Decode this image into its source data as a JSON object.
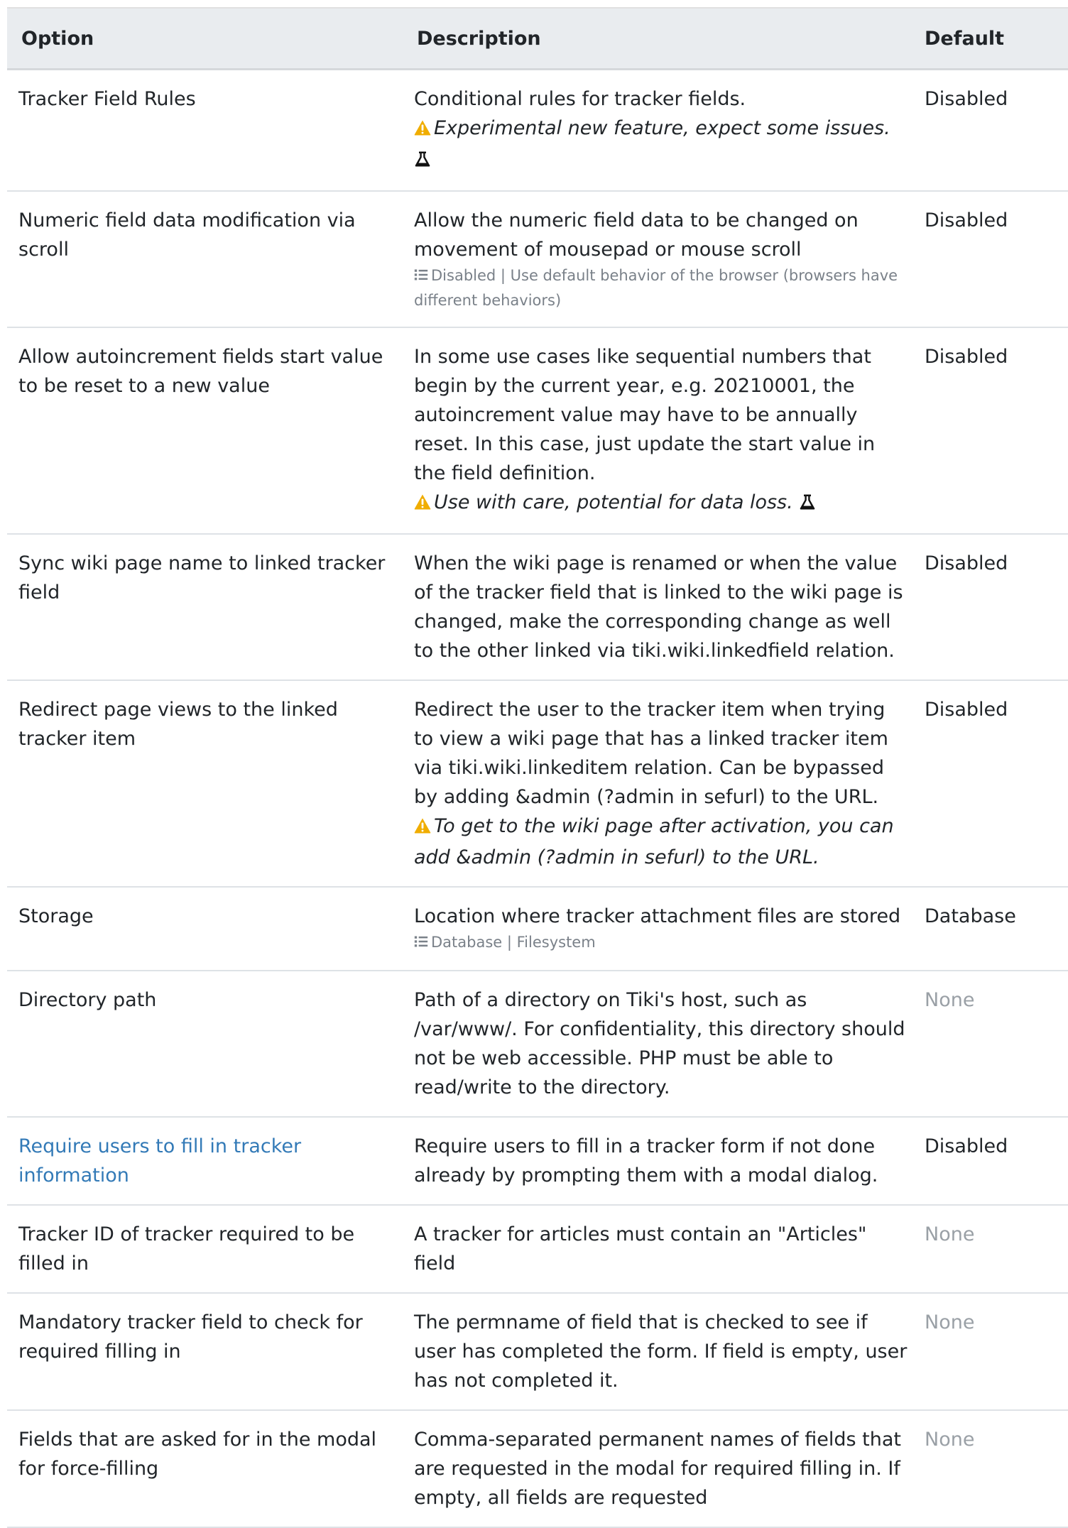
{
  "headers": {
    "option": "Option",
    "description": "Description",
    "default": "Default"
  },
  "rows": [
    {
      "option": "Tracker Field Rules",
      "description": "Conditional rules for tracker fields.",
      "warning": "Experimental new feature, expect some issues.",
      "default": "Disabled"
    },
    {
      "option": "Numeric field data modification via scroll",
      "description": "Allow the numeric field data to be changed on movement of mousepad or mouse scroll",
      "options": "Disabled | Use default behavior of the browser (browsers have different behaviors)",
      "default": "Disabled"
    },
    {
      "option": "Allow autoincrement fields start value to be reset to a new value",
      "description": "In some use cases like sequential numbers that begin by the current year, e.g. 20210001, the autoincrement value may have to be annually reset. In this case, just update the start value in the field definition.",
      "warning": "Use with care, potential for data loss.",
      "default": "Disabled"
    },
    {
      "option": "Sync wiki page name to linked tracker field",
      "description": "When the wiki page is renamed or when the value of the tracker field that is linked to the wiki page is changed, make the corresponding change as well to the other linked via tiki.wiki.linkedfield relation.",
      "default": "Disabled"
    },
    {
      "option": "Redirect page views to the linked tracker item",
      "description": "Redirect the user to the tracker item when trying to view a wiki page that has a linked tracker item via tiki.wiki.linkeditem relation. Can be bypassed by adding &admin (?admin in sefurl) to the URL.",
      "warning": "To get to the wiki page after activation, you can add &admin (?admin in sefurl) to the URL.",
      "default": "Disabled"
    },
    {
      "option": "Storage",
      "description": "Location where tracker attachment files are stored",
      "options": "Database | Filesystem",
      "default": "Database"
    },
    {
      "option": "Directory path",
      "description": "Path of a directory on Tiki's host, such as /var/www/. For confidentiality, this directory should not be web accessible. PHP must be able to read/write to the directory.",
      "default": "None"
    },
    {
      "option": "Require users to fill in tracker information",
      "description": "Require users to fill in a tracker form if not done already by prompting them with a modal dialog.",
      "default": "Disabled"
    },
    {
      "option": "Tracker ID of tracker required to be filled in",
      "description": "A tracker for articles must contain an \"Articles\" field",
      "default": "None"
    },
    {
      "option": "Mandatory tracker field to check for required filling in",
      "description": "The permname of field that is checked to see if user has completed the form. If field is empty, user has not completed it.",
      "default": "None"
    },
    {
      "option": "Fields that are asked for in the modal for force-filling",
      "description": "Comma-separated permanent names of fields that are requested in the modal for required filling in. If empty, all fields are requested",
      "default": "None"
    }
  ],
  "colors": {
    "link": "#337ab7",
    "warning": "#f0ad00",
    "header_bg": "#e9ecef",
    "muted": "#9aa0a6"
  }
}
